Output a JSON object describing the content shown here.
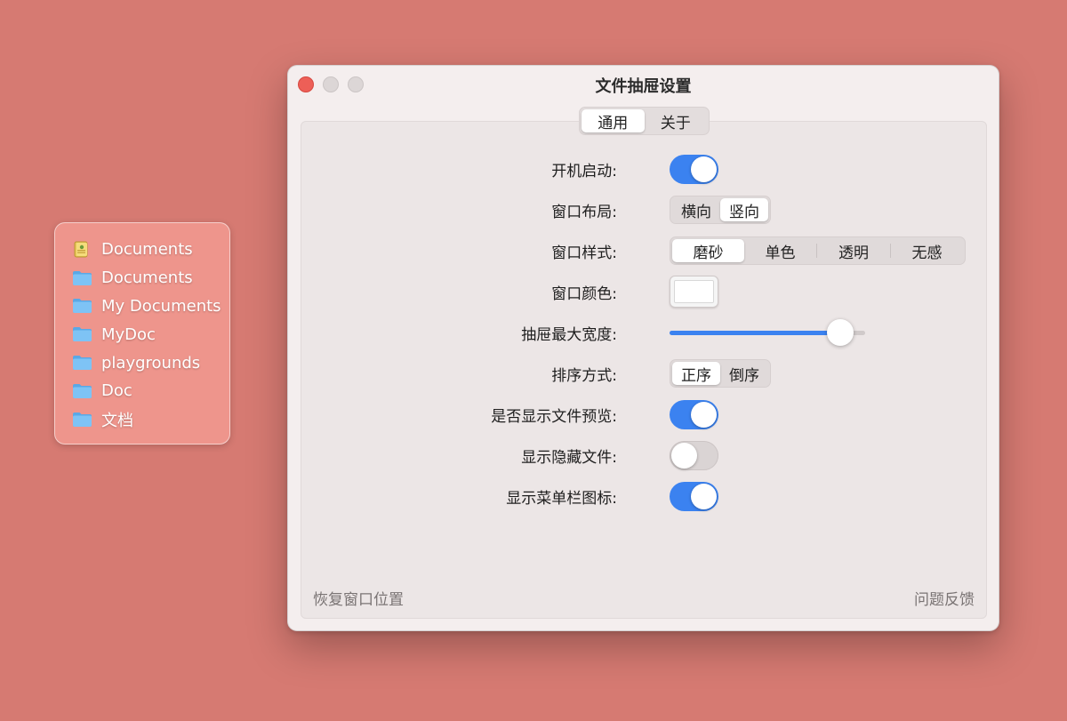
{
  "drawer": {
    "items": [
      {
        "icon": "documents-app-icon",
        "label": "Documents"
      },
      {
        "icon": "folder-icon",
        "label": "Documents"
      },
      {
        "icon": "folder-icon",
        "label": "My Documents"
      },
      {
        "icon": "folder-icon",
        "label": "MyDoc"
      },
      {
        "icon": "folder-icon",
        "label": "playgrounds"
      },
      {
        "icon": "folder-icon",
        "label": "Doc"
      },
      {
        "icon": "folder-icon",
        "label": "文档"
      }
    ]
  },
  "window": {
    "title": "文件抽屉设置",
    "tabs": [
      {
        "label": "通用",
        "active": true
      },
      {
        "label": "关于",
        "active": false
      }
    ],
    "settings": {
      "launch_at_login": {
        "label": "开机启动:",
        "value": true
      },
      "layout": {
        "label": "窗口布局:",
        "options": [
          "横向",
          "竖向"
        ],
        "selected": "竖向"
      },
      "style": {
        "label": "窗口样式:",
        "options": [
          "磨砂",
          "单色",
          "透明",
          "无感"
        ],
        "selected": "磨砂"
      },
      "color": {
        "label": "窗口颜色:",
        "value": "#ffffff"
      },
      "max_width": {
        "label": "抽屉最大宽度:",
        "value_fraction": 0.93
      },
      "sort": {
        "label": "排序方式:",
        "options": [
          "正序",
          "倒序"
        ],
        "selected": "正序"
      },
      "show_preview": {
        "label": "是否显示文件预览:",
        "value": true
      },
      "show_hidden": {
        "label": "显示隐藏文件:",
        "value": false
      },
      "show_menubar_icon": {
        "label": "显示菜单栏图标:",
        "value": true
      }
    },
    "footer": {
      "reset_position": "恢复窗口位置",
      "feedback": "问题反馈"
    }
  },
  "colors": {
    "desktop": "#d67a72",
    "drawer": "#ee958c",
    "accent": "#3b82f0",
    "close": "#ed5f57"
  }
}
